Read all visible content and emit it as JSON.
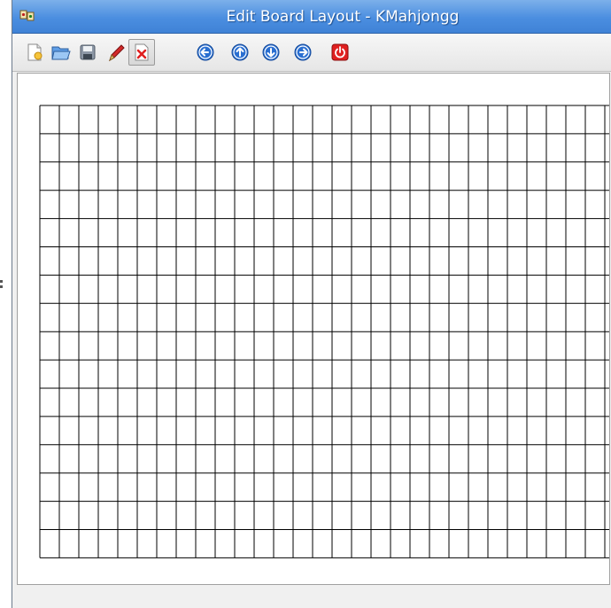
{
  "window": {
    "title": "Edit Board Layout - KMahjongg"
  },
  "toolbar": {
    "buttons": [
      {
        "name": "new",
        "icon": "new-document-icon",
        "active": false
      },
      {
        "name": "open",
        "icon": "open-folder-icon",
        "active": false
      },
      {
        "name": "save",
        "icon": "save-icon",
        "active": false
      },
      {
        "name": "draw",
        "icon": "pencil-icon",
        "active": false
      },
      {
        "name": "erase",
        "icon": "erase-icon",
        "active": true
      },
      {
        "name": "shift-left",
        "icon": "arrow-left-icon",
        "active": false
      },
      {
        "name": "shift-up",
        "icon": "arrow-up-icon",
        "active": false
      },
      {
        "name": "shift-down",
        "icon": "arrow-down-icon",
        "active": false
      },
      {
        "name": "shift-right",
        "icon": "arrow-right-icon",
        "active": false
      },
      {
        "name": "close",
        "icon": "power-icon",
        "active": false
      }
    ]
  },
  "board": {
    "columns": 30,
    "rows": 16,
    "grid_color": "#000000"
  },
  "colors": {
    "titlebar": "#4b8ee0",
    "accent_blue": "#2a6fd1",
    "close_red": "#e02020"
  }
}
